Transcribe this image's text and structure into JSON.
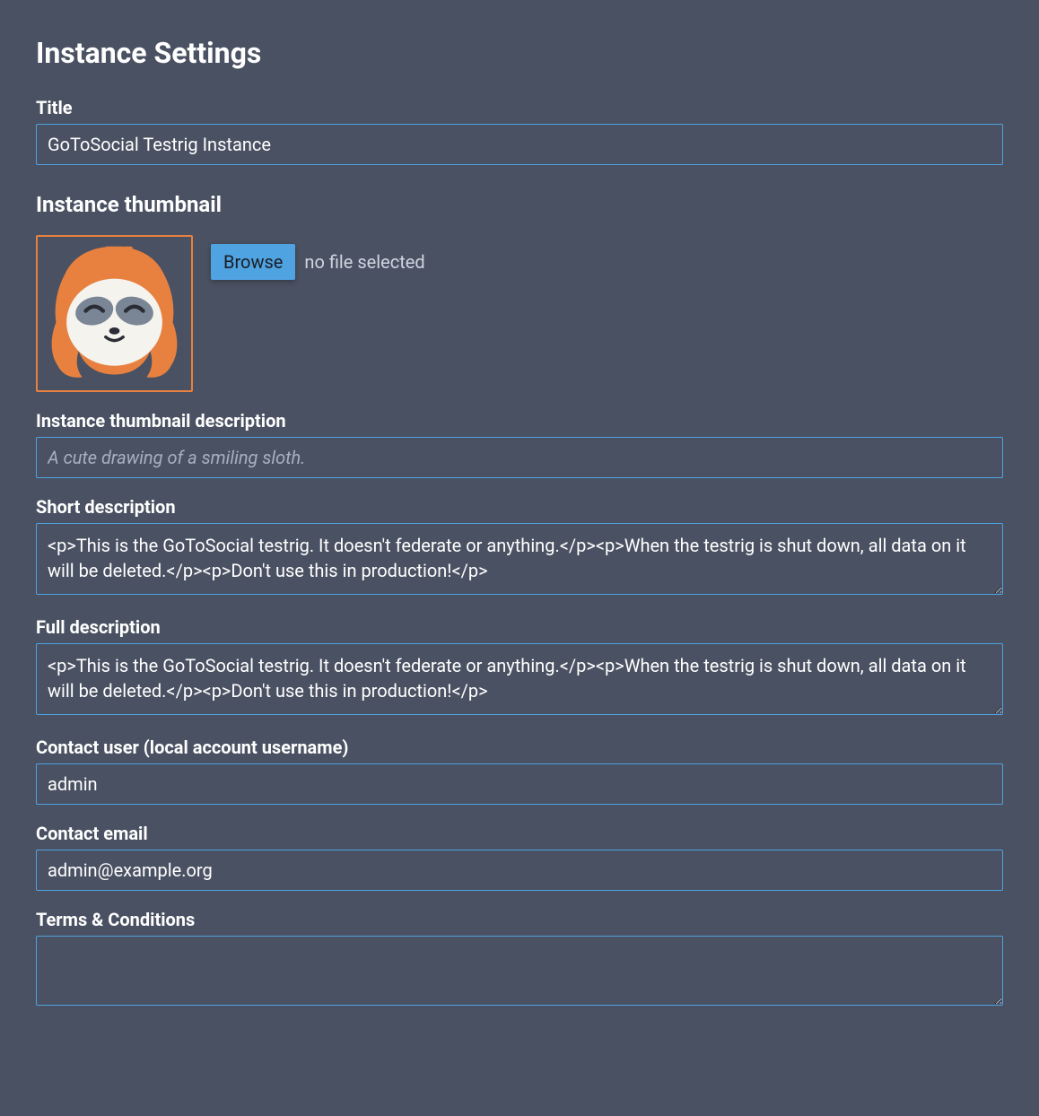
{
  "page": {
    "title": "Instance Settings"
  },
  "title_field": {
    "label": "Title",
    "value": "GoToSocial Testrig Instance"
  },
  "thumbnail": {
    "heading": "Instance thumbnail",
    "browse_label": "Browse",
    "file_status": "no file selected",
    "icon_name": "sloth-avatar"
  },
  "thumbnail_desc": {
    "label": "Instance thumbnail description",
    "placeholder": "A cute drawing of a smiling sloth.",
    "value": ""
  },
  "short_desc": {
    "label": "Short description",
    "value": "<p>This is the GoToSocial testrig. It doesn't federate or anything.</p><p>When the testrig is shut down, all data on it will be deleted.</p><p>Don't use this in production!</p>"
  },
  "full_desc": {
    "label": "Full description",
    "value": "<p>This is the GoToSocial testrig. It doesn't federate or anything.</p><p>When the testrig is shut down, all data on it will be deleted.</p><p>Don't use this in production!</p>"
  },
  "contact_user": {
    "label": "Contact user (local account username)",
    "value": "admin"
  },
  "contact_email": {
    "label": "Contact email",
    "value": "admin@example.org"
  },
  "terms": {
    "label": "Terms & Conditions",
    "value": ""
  }
}
